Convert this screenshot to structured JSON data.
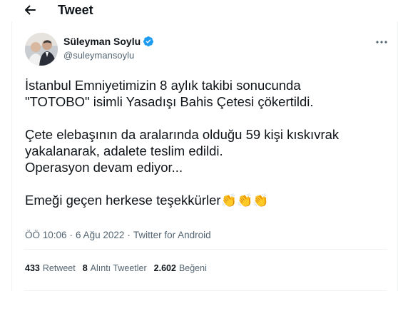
{
  "header": {
    "title": "Tweet"
  },
  "author": {
    "name": "Süleyman Soylu",
    "handle": "@suleymansoylu",
    "verified": true
  },
  "tweet": {
    "lines": [
      "İstanbul Emniyetimizin 8 aylık takibi sonucunda",
      "\"TOTOBO\" isimli Yasadışı Bahis Çetesi çökertildi.",
      "",
      "Çete elebaşının da aralarında olduğu 59 kişi kıskıvrak",
      "yakalanarak, adalete teslim edildi.",
      "Operasyon devam ediyor...",
      "",
      "Emeği geçen herkese teşekkürler"
    ],
    "emoji": "👏👏👏"
  },
  "meta": {
    "time": "ÖÖ 10:06",
    "separator": "·",
    "date": "6 Ağu 2022",
    "source": "Twitter for Android"
  },
  "stats": {
    "retweets": {
      "count": "433",
      "label": "Retweet"
    },
    "quotes": {
      "count": "8",
      "label": "Alıntı Tweetler"
    },
    "likes": {
      "count": "2.602",
      "label": "Beğeni"
    }
  },
  "colors": {
    "text": "#0f1419",
    "secondary": "#536471",
    "verified": "#1d9bf0",
    "border": "#eff3f4"
  }
}
